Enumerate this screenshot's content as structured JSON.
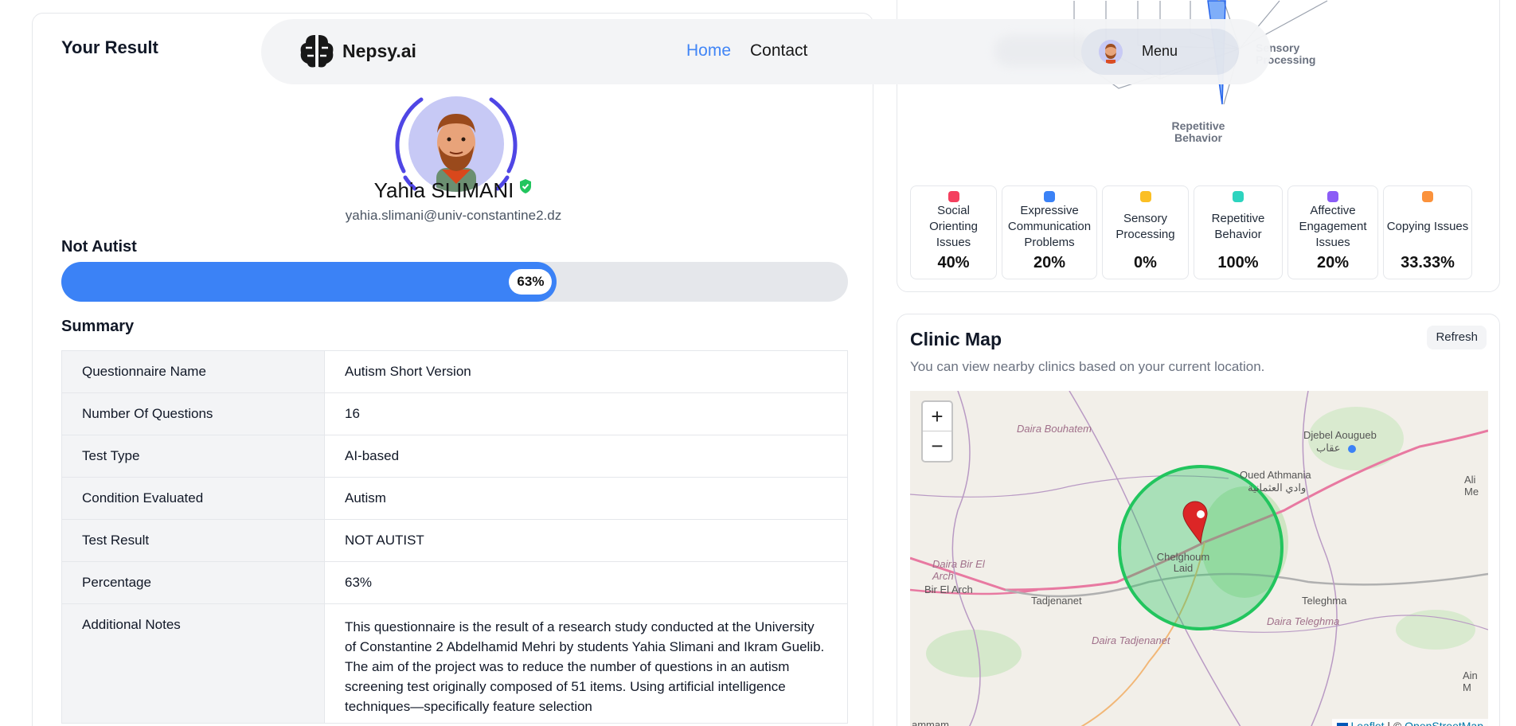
{
  "navbar": {
    "brand": "Nepsy.ai",
    "links": [
      "Home",
      "Contact"
    ],
    "menu_label": "Menu"
  },
  "result": {
    "title": "Your Result",
    "user_name": "Yahia SLIMANI",
    "user_email": "yahia.slimani@univ-constantine2.dz",
    "status": "Not Autist",
    "progress_percent": 63,
    "progress_label": "63%",
    "summary_title": "Summary",
    "rows": [
      {
        "key": "Questionnaire Name",
        "value": "Autism Short Version"
      },
      {
        "key": "Number Of Questions",
        "value": "16"
      },
      {
        "key": "Test Type",
        "value": "AI-based"
      },
      {
        "key": "Condition Evaluated",
        "value": "Autism"
      },
      {
        "key": "Test Result",
        "value": "NOT AUTIST"
      },
      {
        "key": "Percentage",
        "value": "63%"
      },
      {
        "key": "Additional Notes",
        "value": "This questionnaire is the result of a research study conducted at the University of Constantine 2 Abdelhamid Mehri by students Yahia Slimani and Ikram Guelib. The aim of the project was to reduce the number of questions in an autism screening test originally composed of 51 items. Using artificial intelligence techniques—specifically feature selection"
      }
    ]
  },
  "radar": {
    "axis_labels": [
      "Sensory Processing",
      "Repetitive Behavior"
    ],
    "tiles": [
      {
        "label": "Social Orienting Issues",
        "value": "40%",
        "color": "#f43f5e"
      },
      {
        "label": "Expressive Communication Problems",
        "value": "20%",
        "color": "#3b82f6"
      },
      {
        "label": "Sensory Processing",
        "value": "0%",
        "color": "#fbbf24"
      },
      {
        "label": "Repetitive Behavior",
        "value": "100%",
        "color": "#2dd4bf"
      },
      {
        "label": "Affective Engagement Issues",
        "value": "20%",
        "color": "#8b5cf6"
      },
      {
        "label": "Copying Issues",
        "value": "33.33%",
        "color": "#fb923c"
      }
    ]
  },
  "clinic": {
    "title": "Clinic Map",
    "subtitle": "You can view nearby clinics based on your current location.",
    "refresh_label": "Refresh",
    "zoom_in": "+",
    "zoom_out": "−",
    "attribution_leaflet": "Leaflet",
    "attribution_sep": "| ©",
    "attribution_osm": "OpenStreetMap",
    "places": [
      "Daira Bouhatem",
      "Djebel Aougueb",
      "عقاب",
      "Oued Athmania",
      "وادي العثمانية",
      "Daira Bir El Arch",
      "Bir El Arch",
      "Chelghoum Laid",
      "Tadjenanet",
      "Teleghma",
      "Daira Teleghma",
      "Daira Tadjenanet",
      "Ain M",
      "Ali Me",
      "ammam"
    ]
  }
}
